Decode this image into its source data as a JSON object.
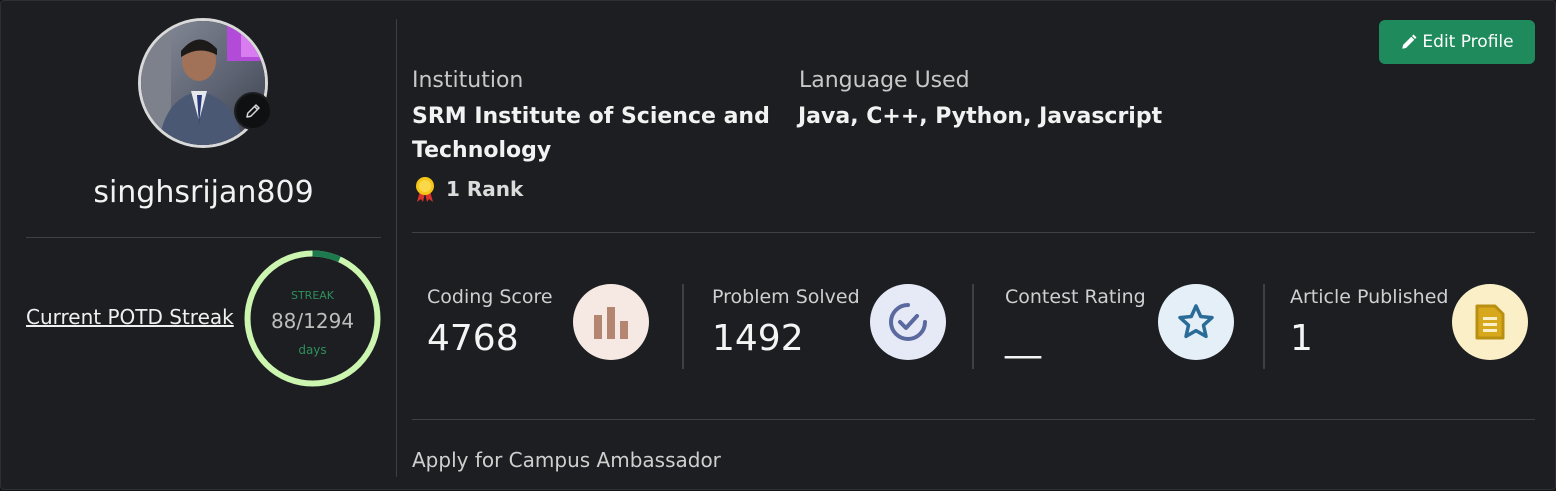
{
  "profile": {
    "username": "singhsrijan809",
    "potd_link": "Current POTD Streak",
    "streak": {
      "label": "STREAK",
      "current": "88",
      "total": "/1294",
      "unit": "days",
      "progress": 0.068
    }
  },
  "header": {
    "edit_label": "Edit Profile"
  },
  "info": {
    "institution_label": "Institution",
    "institution_value_line1": "SRM Institute of Science and",
    "institution_value_line2": "Technology",
    "language_label": "Language Used",
    "language_value": "Java, C++, Python, Javascript",
    "rank_text": "1 Rank"
  },
  "stats": [
    {
      "label": "Coding Score",
      "value": "4768",
      "icon": "bar-chart-icon",
      "icon_bg": "#f6e8e2",
      "icon_color": "#b48570"
    },
    {
      "label": "Problem Solved",
      "value": "1492",
      "icon": "check-circle-icon",
      "icon_bg": "#e6e9f6",
      "icon_color": "#5a6a9e"
    },
    {
      "label": "Contest Rating",
      "value": "__",
      "icon": "star-icon",
      "icon_bg": "#e4eff8",
      "icon_color": "#2a6b97"
    },
    {
      "label": "Article Published",
      "value": "1",
      "icon": "document-icon",
      "icon_bg": "#fbefc7",
      "icon_color": "#b88f11"
    }
  ],
  "footer": {
    "campus_label": "Apply for Campus Ambassador"
  },
  "colors": {
    "accent": "#1f8a5c",
    "streak_track": "#ccf5b0",
    "streak_fill": "#1d7a4f"
  }
}
